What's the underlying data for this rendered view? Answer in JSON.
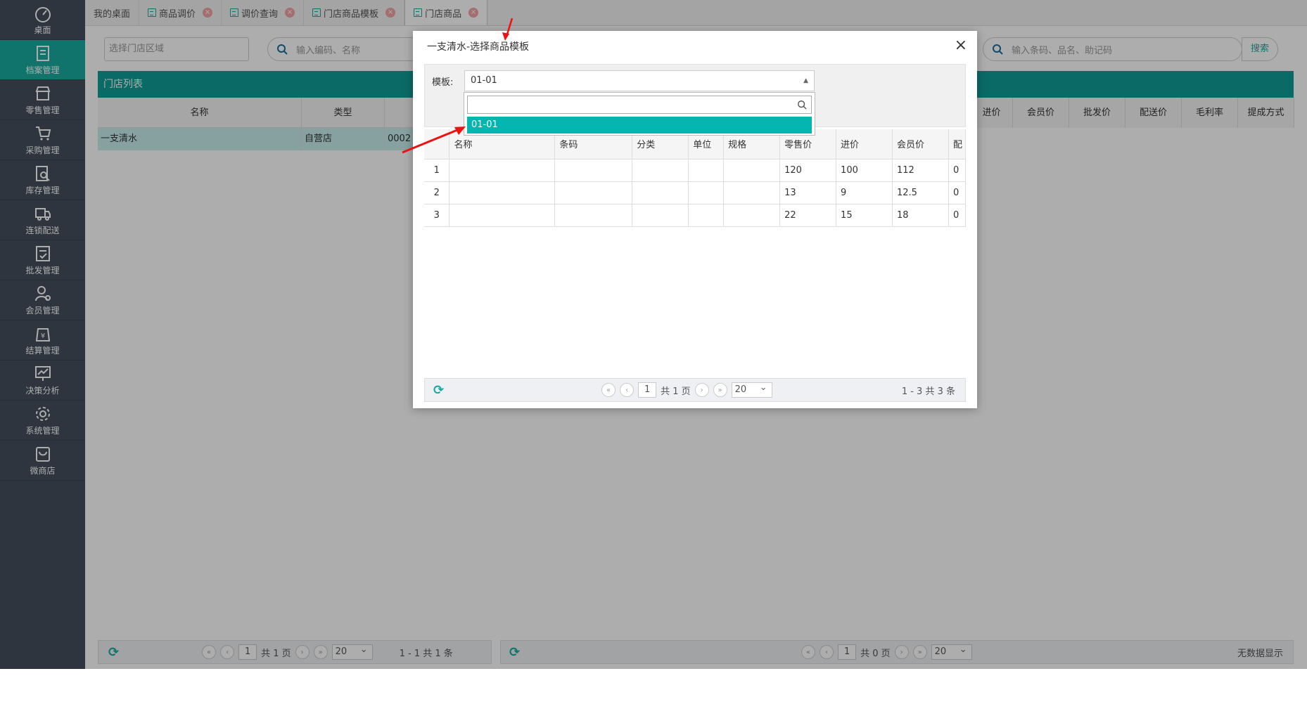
{
  "sidebar": {
    "items": [
      {
        "label": "桌面",
        "icon": "dashboard-icon"
      },
      {
        "label": "档案管理",
        "icon": "archive-icon",
        "active": true
      },
      {
        "label": "零售管理",
        "icon": "store-icon"
      },
      {
        "label": "采购管理",
        "icon": "cart-icon"
      },
      {
        "label": "库存管理",
        "icon": "inventory-icon"
      },
      {
        "label": "连锁配送",
        "icon": "truck-icon"
      },
      {
        "label": "批发管理",
        "icon": "wholesale-icon"
      },
      {
        "label": "会员管理",
        "icon": "member-icon"
      },
      {
        "label": "结算管理",
        "icon": "settlement-icon"
      },
      {
        "label": "决策分析",
        "icon": "chart-icon"
      },
      {
        "label": "系统管理",
        "icon": "gear-icon"
      },
      {
        "label": "微商店",
        "icon": "bag-icon"
      }
    ]
  },
  "tabs": [
    {
      "label": "我的桌面",
      "closable": false
    },
    {
      "label": "商品调价",
      "closable": true
    },
    {
      "label": "调价查询",
      "closable": true
    },
    {
      "label": "门店商品模板",
      "closable": true
    },
    {
      "label": "门店商品",
      "closable": true,
      "active": true
    }
  ],
  "filters": {
    "region_placeholder": "选择门店区域",
    "left_search_placeholder": "输入编码、名称",
    "right_search_placeholder": "输入条码、品名、助记码",
    "search_button": "搜索"
  },
  "store_panel": {
    "title": "门店列表",
    "columns": [
      "名称",
      "类型",
      ""
    ],
    "rows": [
      [
        "一支清水",
        "自营店",
        "0002"
      ]
    ]
  },
  "goods_panel": {
    "columns": [
      "进价",
      "会员价",
      "批发价",
      "配送价",
      "毛利率",
      "提成方式"
    ]
  },
  "left_pager": {
    "page": "1",
    "total_pages": "共 1 页",
    "page_size": "20",
    "summary": "1 - 1  共 1 条"
  },
  "right_pager": {
    "page": "1",
    "total_pages": "共 0 页",
    "page_size": "20",
    "summary": "无数据显示"
  },
  "modal": {
    "title": "一支清水-选择商品模板",
    "template_label": "模板:",
    "template_value": "01-01",
    "dropdown_option": "01-01",
    "columns": [
      "",
      "名称",
      "条码",
      "分类",
      "单位",
      "规格",
      "零售价",
      "进价",
      "会员价",
      "配"
    ],
    "rows": [
      [
        "1",
        "",
        "",
        "",
        "",
        "",
        "120",
        "100",
        "112",
        "0"
      ],
      [
        "2",
        "",
        "",
        "",
        "",
        "",
        "13",
        "9",
        "12.5",
        "0"
      ],
      [
        "3",
        "",
        "",
        "",
        "",
        "",
        "22",
        "15",
        "18",
        "0"
      ]
    ],
    "pager": {
      "page": "1",
      "total_pages": "共 1 页",
      "page_size": "20",
      "summary": "1 - 3   共 3 条"
    }
  },
  "colors": {
    "sidebar": "#444f5e",
    "accent": "#1aaba0",
    "option": "#05b5b0"
  }
}
